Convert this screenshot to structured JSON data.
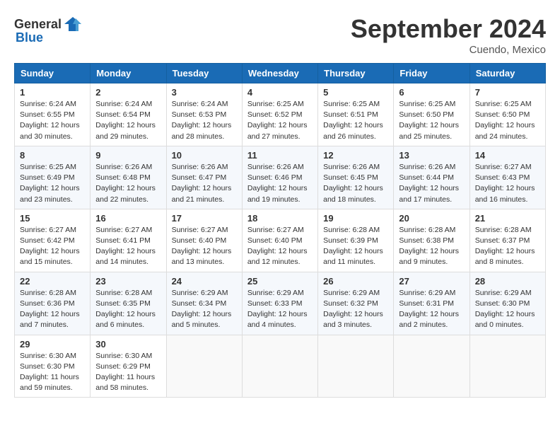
{
  "header": {
    "logo_general": "General",
    "logo_blue": "Blue",
    "month_year": "September 2024",
    "location": "Cuendo, Mexico"
  },
  "days_of_week": [
    "Sunday",
    "Monday",
    "Tuesday",
    "Wednesday",
    "Thursday",
    "Friday",
    "Saturday"
  ],
  "weeks": [
    [
      {
        "day": "1",
        "sunrise": "6:24 AM",
        "sunset": "6:55 PM",
        "daylight": "12 hours and 30 minutes."
      },
      {
        "day": "2",
        "sunrise": "6:24 AM",
        "sunset": "6:54 PM",
        "daylight": "12 hours and 29 minutes."
      },
      {
        "day": "3",
        "sunrise": "6:24 AM",
        "sunset": "6:53 PM",
        "daylight": "12 hours and 28 minutes."
      },
      {
        "day": "4",
        "sunrise": "6:25 AM",
        "sunset": "6:52 PM",
        "daylight": "12 hours and 27 minutes."
      },
      {
        "day": "5",
        "sunrise": "6:25 AM",
        "sunset": "6:51 PM",
        "daylight": "12 hours and 26 minutes."
      },
      {
        "day": "6",
        "sunrise": "6:25 AM",
        "sunset": "6:50 PM",
        "daylight": "12 hours and 25 minutes."
      },
      {
        "day": "7",
        "sunrise": "6:25 AM",
        "sunset": "6:50 PM",
        "daylight": "12 hours and 24 minutes."
      }
    ],
    [
      {
        "day": "8",
        "sunrise": "6:25 AM",
        "sunset": "6:49 PM",
        "daylight": "12 hours and 23 minutes."
      },
      {
        "day": "9",
        "sunrise": "6:26 AM",
        "sunset": "6:48 PM",
        "daylight": "12 hours and 22 minutes."
      },
      {
        "day": "10",
        "sunrise": "6:26 AM",
        "sunset": "6:47 PM",
        "daylight": "12 hours and 21 minutes."
      },
      {
        "day": "11",
        "sunrise": "6:26 AM",
        "sunset": "6:46 PM",
        "daylight": "12 hours and 19 minutes."
      },
      {
        "day": "12",
        "sunrise": "6:26 AM",
        "sunset": "6:45 PM",
        "daylight": "12 hours and 18 minutes."
      },
      {
        "day": "13",
        "sunrise": "6:26 AM",
        "sunset": "6:44 PM",
        "daylight": "12 hours and 17 minutes."
      },
      {
        "day": "14",
        "sunrise": "6:27 AM",
        "sunset": "6:43 PM",
        "daylight": "12 hours and 16 minutes."
      }
    ],
    [
      {
        "day": "15",
        "sunrise": "6:27 AM",
        "sunset": "6:42 PM",
        "daylight": "12 hours and 15 minutes."
      },
      {
        "day": "16",
        "sunrise": "6:27 AM",
        "sunset": "6:41 PM",
        "daylight": "12 hours and 14 minutes."
      },
      {
        "day": "17",
        "sunrise": "6:27 AM",
        "sunset": "6:40 PM",
        "daylight": "12 hours and 13 minutes."
      },
      {
        "day": "18",
        "sunrise": "6:27 AM",
        "sunset": "6:40 PM",
        "daylight": "12 hours and 12 minutes."
      },
      {
        "day": "19",
        "sunrise": "6:28 AM",
        "sunset": "6:39 PM",
        "daylight": "12 hours and 11 minutes."
      },
      {
        "day": "20",
        "sunrise": "6:28 AM",
        "sunset": "6:38 PM",
        "daylight": "12 hours and 9 minutes."
      },
      {
        "day": "21",
        "sunrise": "6:28 AM",
        "sunset": "6:37 PM",
        "daylight": "12 hours and 8 minutes."
      }
    ],
    [
      {
        "day": "22",
        "sunrise": "6:28 AM",
        "sunset": "6:36 PM",
        "daylight": "12 hours and 7 minutes."
      },
      {
        "day": "23",
        "sunrise": "6:28 AM",
        "sunset": "6:35 PM",
        "daylight": "12 hours and 6 minutes."
      },
      {
        "day": "24",
        "sunrise": "6:29 AM",
        "sunset": "6:34 PM",
        "daylight": "12 hours and 5 minutes."
      },
      {
        "day": "25",
        "sunrise": "6:29 AM",
        "sunset": "6:33 PM",
        "daylight": "12 hours and 4 minutes."
      },
      {
        "day": "26",
        "sunrise": "6:29 AM",
        "sunset": "6:32 PM",
        "daylight": "12 hours and 3 minutes."
      },
      {
        "day": "27",
        "sunrise": "6:29 AM",
        "sunset": "6:31 PM",
        "daylight": "12 hours and 2 minutes."
      },
      {
        "day": "28",
        "sunrise": "6:29 AM",
        "sunset": "6:30 PM",
        "daylight": "12 hours and 0 minutes."
      }
    ],
    [
      {
        "day": "29",
        "sunrise": "6:30 AM",
        "sunset": "6:30 PM",
        "daylight": "11 hours and 59 minutes."
      },
      {
        "day": "30",
        "sunrise": "6:30 AM",
        "sunset": "6:29 PM",
        "daylight": "11 hours and 58 minutes."
      },
      null,
      null,
      null,
      null,
      null
    ]
  ]
}
